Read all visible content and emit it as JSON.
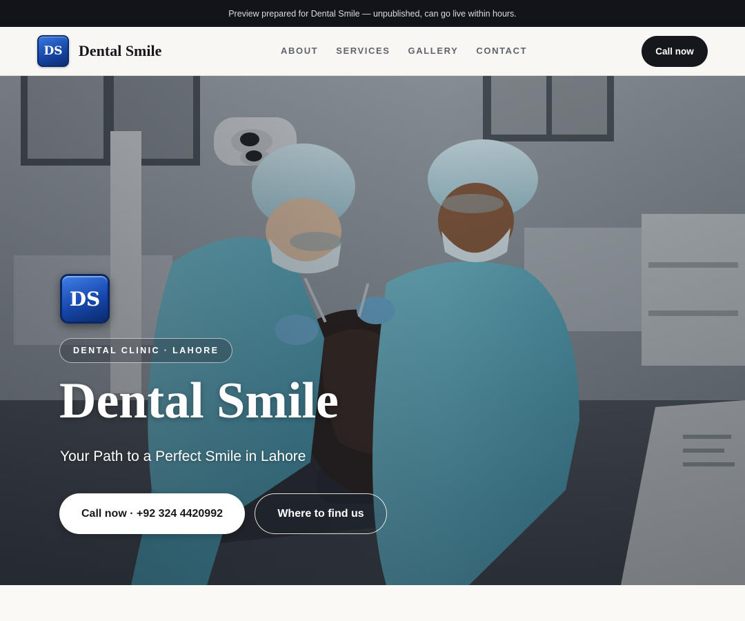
{
  "preview_banner": {
    "text": "Preview prepared for Dental Smile — unpublished, can go live within hours."
  },
  "header": {
    "logo_monogram": "DS",
    "brand_name": "Dental Smile",
    "nav": [
      "ABOUT",
      "SERVICES",
      "GALLERY",
      "CONTACT"
    ],
    "call_button": "Call now"
  },
  "hero": {
    "logo_monogram": "DS",
    "tag": "DENTAL CLINIC · LAHORE",
    "title": "Dental Smile",
    "subtitle": "Your Path to a Perfect Smile in Lahore",
    "primary_button": "Call now · +92 324 4420992",
    "secondary_button": "Where to find us"
  },
  "colors": {
    "banner_bg": "#12141a",
    "header_bg": "#f8f7f4",
    "dark_button": "#15171c",
    "logo_blue": "#1747a8",
    "scrubs_teal": "#5fb3c9"
  }
}
